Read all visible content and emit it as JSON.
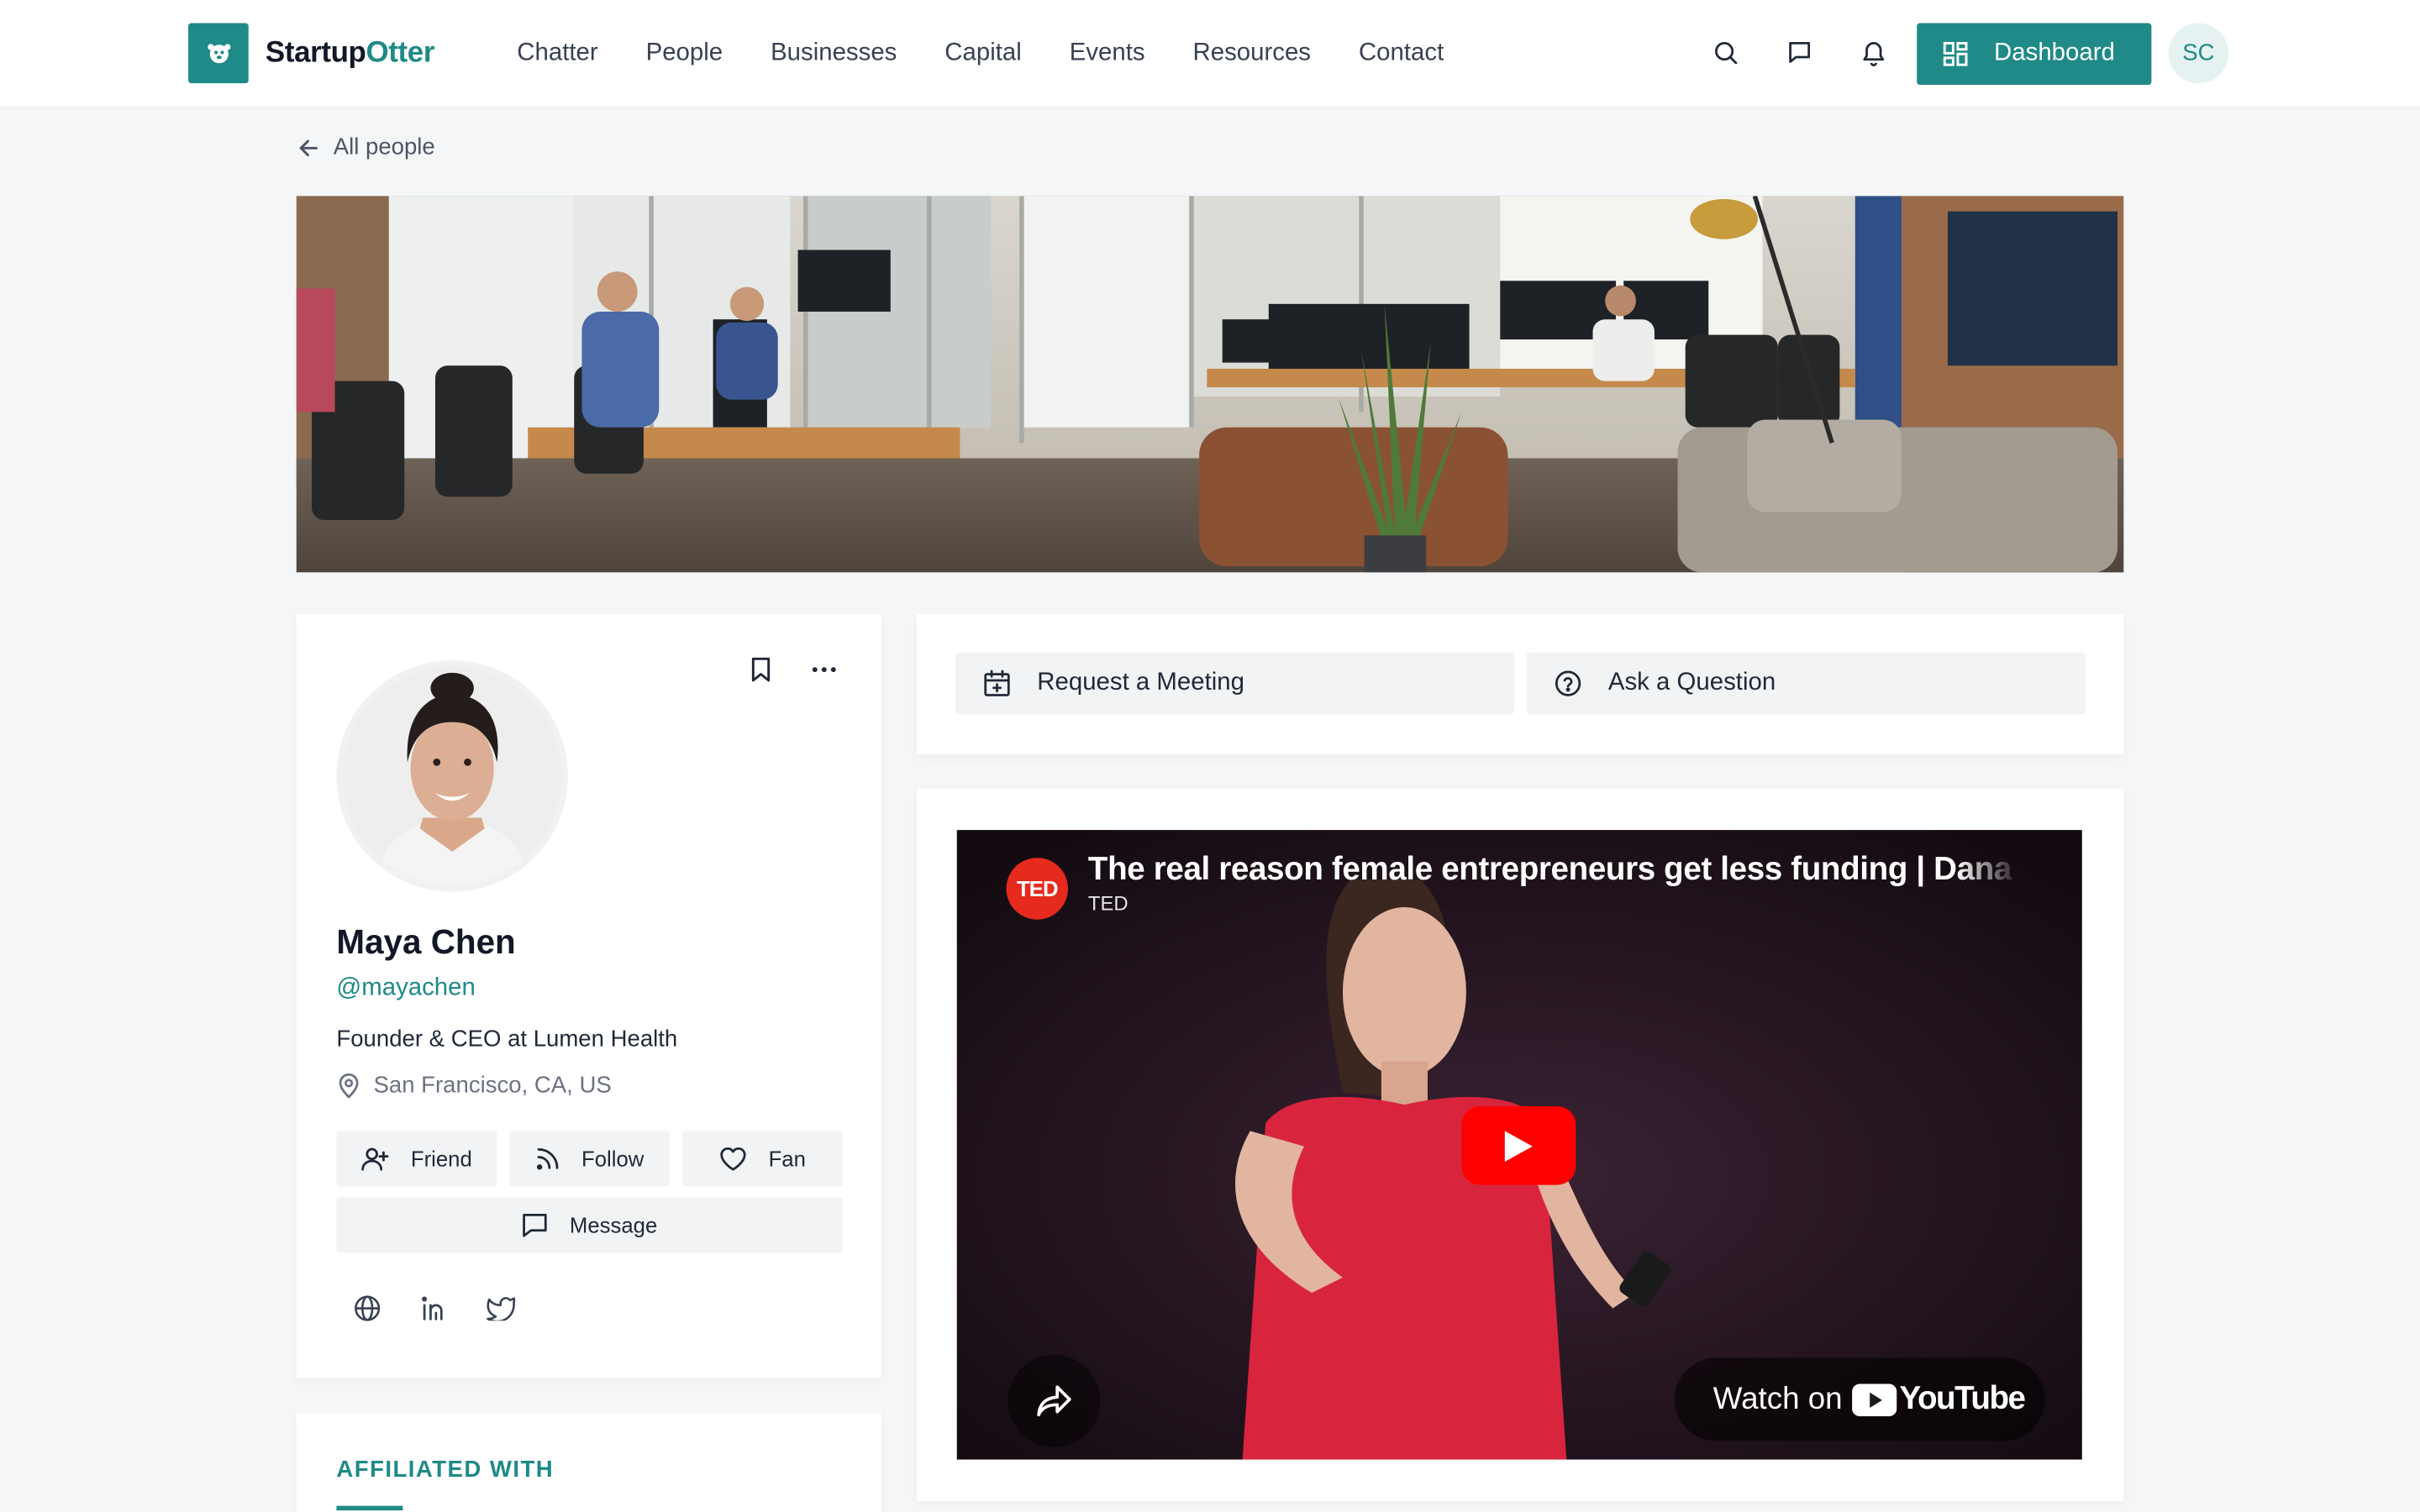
{
  "brand": {
    "name_a": "Startup",
    "name_b": "Otter",
    "accent": "#1f8a87"
  },
  "nav": {
    "links": [
      "Chatter",
      "People",
      "Businesses",
      "Capital",
      "Events",
      "Resources",
      "Contact"
    ],
    "icons": [
      "search-icon",
      "chat-icon",
      "bell-icon"
    ],
    "dashboard_label": "Dashboard",
    "user_initials": "SC"
  },
  "back_link": "All people",
  "profile": {
    "name": "Maya Chen",
    "handle": "@mayachen",
    "title": "Founder & CEO at Lumen Health",
    "location": "San Francisco, CA, US",
    "buttons": {
      "friend": "Friend",
      "follow": "Follow",
      "fan": "Fan",
      "message": "Message"
    },
    "social_icons": [
      "globe-icon",
      "linkedin-icon",
      "twitter-icon"
    ]
  },
  "affiliated": {
    "title": "AFFILIATED WITH"
  },
  "actions": {
    "meeting": "Request a Meeting",
    "question": "Ask a Question"
  },
  "video": {
    "title": "The real reason female entrepreneurs get less funding | Dana Kanze",
    "channel": "TED",
    "channel_logo": "TED",
    "watch_on": "Watch on",
    "youtube": "YouTube"
  }
}
